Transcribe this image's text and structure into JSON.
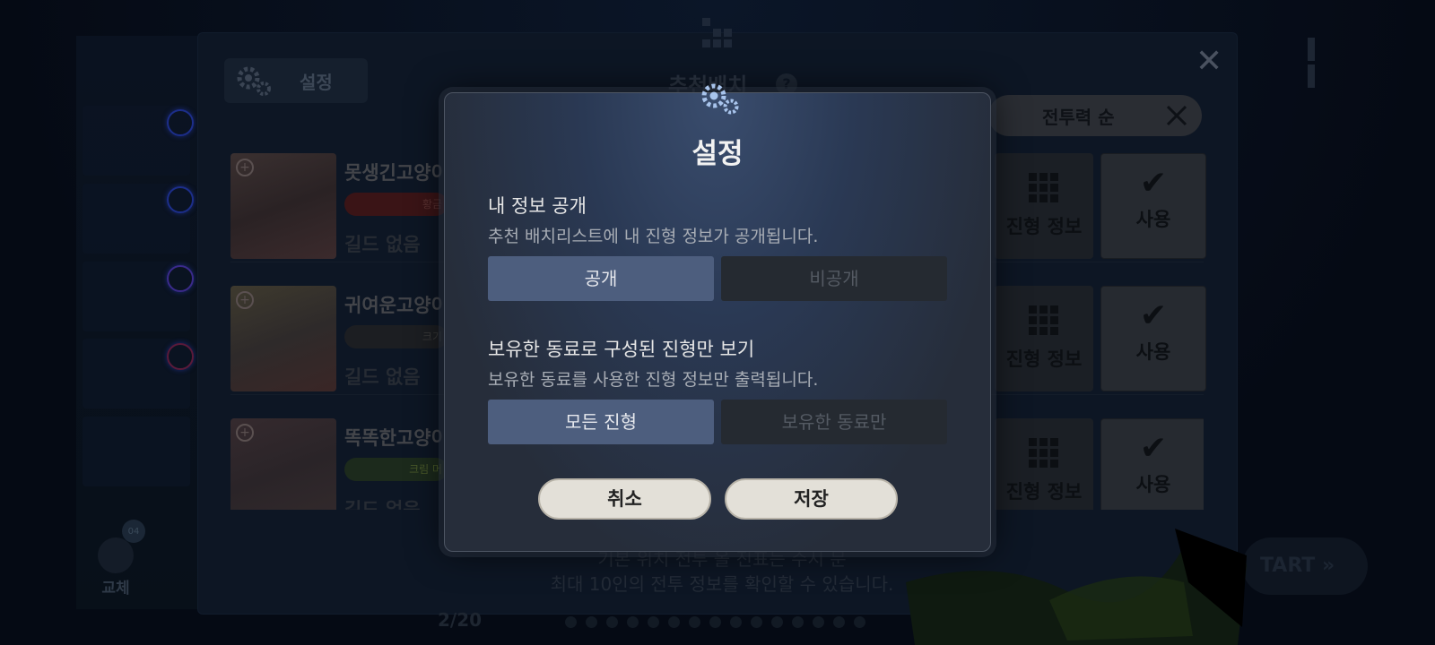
{
  "background": {
    "panel_title": "추천배치",
    "settings_chip_label": "설정",
    "sort_label": "전투력 순",
    "rows": [
      {
        "name": "못생긴고양이",
        "badge": "황금",
        "guild": "길드 없음",
        "formation_label": "진형 정보",
        "use_label": "사용"
      },
      {
        "name": "귀여운고양이",
        "badge": "크기",
        "guild": "길드 없음",
        "formation_label": "진형 정보",
        "use_label": "사용"
      },
      {
        "name": "똑똑한고양이",
        "badge": "크림 머",
        "guild": "길드 없음",
        "formation_label": "진형 정보",
        "use_label": "사용"
      }
    ],
    "bottom_message_line1": "기본 위치 전투 올 진표는 수시 문",
    "bottom_message_line2": "최대 10인의 전투 정보를 확인할 수 있습니다.",
    "page_indicator": "2/20",
    "swap_label": "교체",
    "swap_badge": "04",
    "start_label": "TART »"
  },
  "modal": {
    "title": "설정",
    "section1": {
      "title": "내 정보 공개",
      "description": "추천 배치리스트에 내 진형 정보가 공개됩니다.",
      "option_on": "공개",
      "option_off": "비공개",
      "selected": "공개"
    },
    "section2": {
      "title": "보유한 동료로 구성된 진형만 보기",
      "description": "보유한 동료를 사용한 진형 정보만 출력됩니다.",
      "option_on": "모든 진형",
      "option_off": "보유한 동료만",
      "selected": "모든 진형"
    },
    "cancel_label": "취소",
    "save_label": "저장"
  },
  "colors": {
    "modal_bg": "#262d3a",
    "toggle_selected": "#4d5e7e",
    "toggle_unselected": "#252a31",
    "button_bg": "#e3e0d8"
  },
  "icons": [
    "gear-icon",
    "close-icon",
    "pause-icon",
    "formation-grid-icon",
    "check-icon",
    "help-icon",
    "sort-swords-icon"
  ]
}
